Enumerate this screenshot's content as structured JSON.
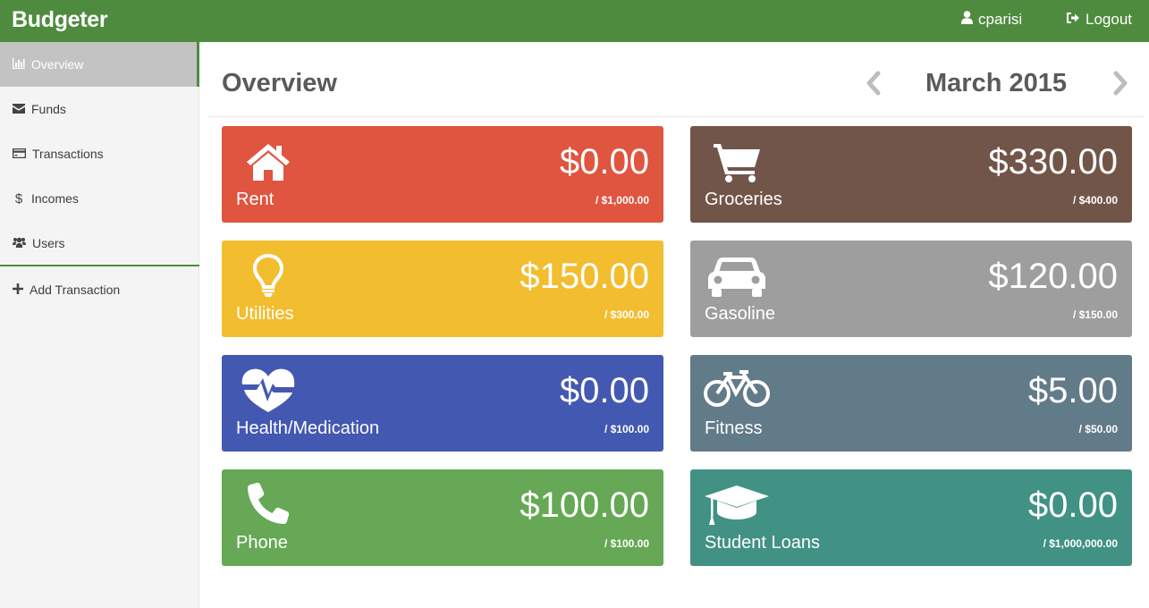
{
  "app": {
    "brand": "Budgeter",
    "user": "cparisi",
    "logout": "Logout"
  },
  "sidebar": {
    "items": [
      {
        "label": "Overview",
        "icon": "bar-chart-icon"
      },
      {
        "label": "Funds",
        "icon": "envelope-icon"
      },
      {
        "label": "Transactions",
        "icon": "credit-card-icon"
      },
      {
        "label": "Incomes",
        "icon": "dollar-icon"
      },
      {
        "label": "Users",
        "icon": "users-icon"
      }
    ],
    "add_transaction": "Add Transaction"
  },
  "header": {
    "title": "Overview",
    "month": "March 2015"
  },
  "colors": {
    "brand_green": "#4f8b3e",
    "rent": "#e05540",
    "groceries": "#725549",
    "utilities": "#f2bd2f",
    "gasoline": "#9e9e9e",
    "health": "#4358b1",
    "fitness": "#627b88",
    "phone": "#66a855",
    "student_loans": "#419184"
  },
  "funds": [
    {
      "name": "Rent",
      "amount": "$0.00",
      "limit": "/ $1,000.00",
      "icon": "home-icon"
    },
    {
      "name": "Groceries",
      "amount": "$330.00",
      "limit": "/ $400.00",
      "icon": "shopping-cart-icon"
    },
    {
      "name": "Utilities",
      "amount": "$150.00",
      "limit": "/ $300.00",
      "icon": "lightbulb-icon"
    },
    {
      "name": "Gasoline",
      "amount": "$120.00",
      "limit": "/ $150.00",
      "icon": "car-icon"
    },
    {
      "name": "Health/Medication",
      "amount": "$0.00",
      "limit": "/ $100.00",
      "icon": "heartbeat-icon"
    },
    {
      "name": "Fitness",
      "amount": "$5.00",
      "limit": "/ $50.00",
      "icon": "bicycle-icon"
    },
    {
      "name": "Phone",
      "amount": "$100.00",
      "limit": "/ $100.00",
      "icon": "phone-icon"
    },
    {
      "name": "Student Loans",
      "amount": "$0.00",
      "limit": "/ $1,000,000.00",
      "icon": "graduation-cap-icon"
    }
  ]
}
